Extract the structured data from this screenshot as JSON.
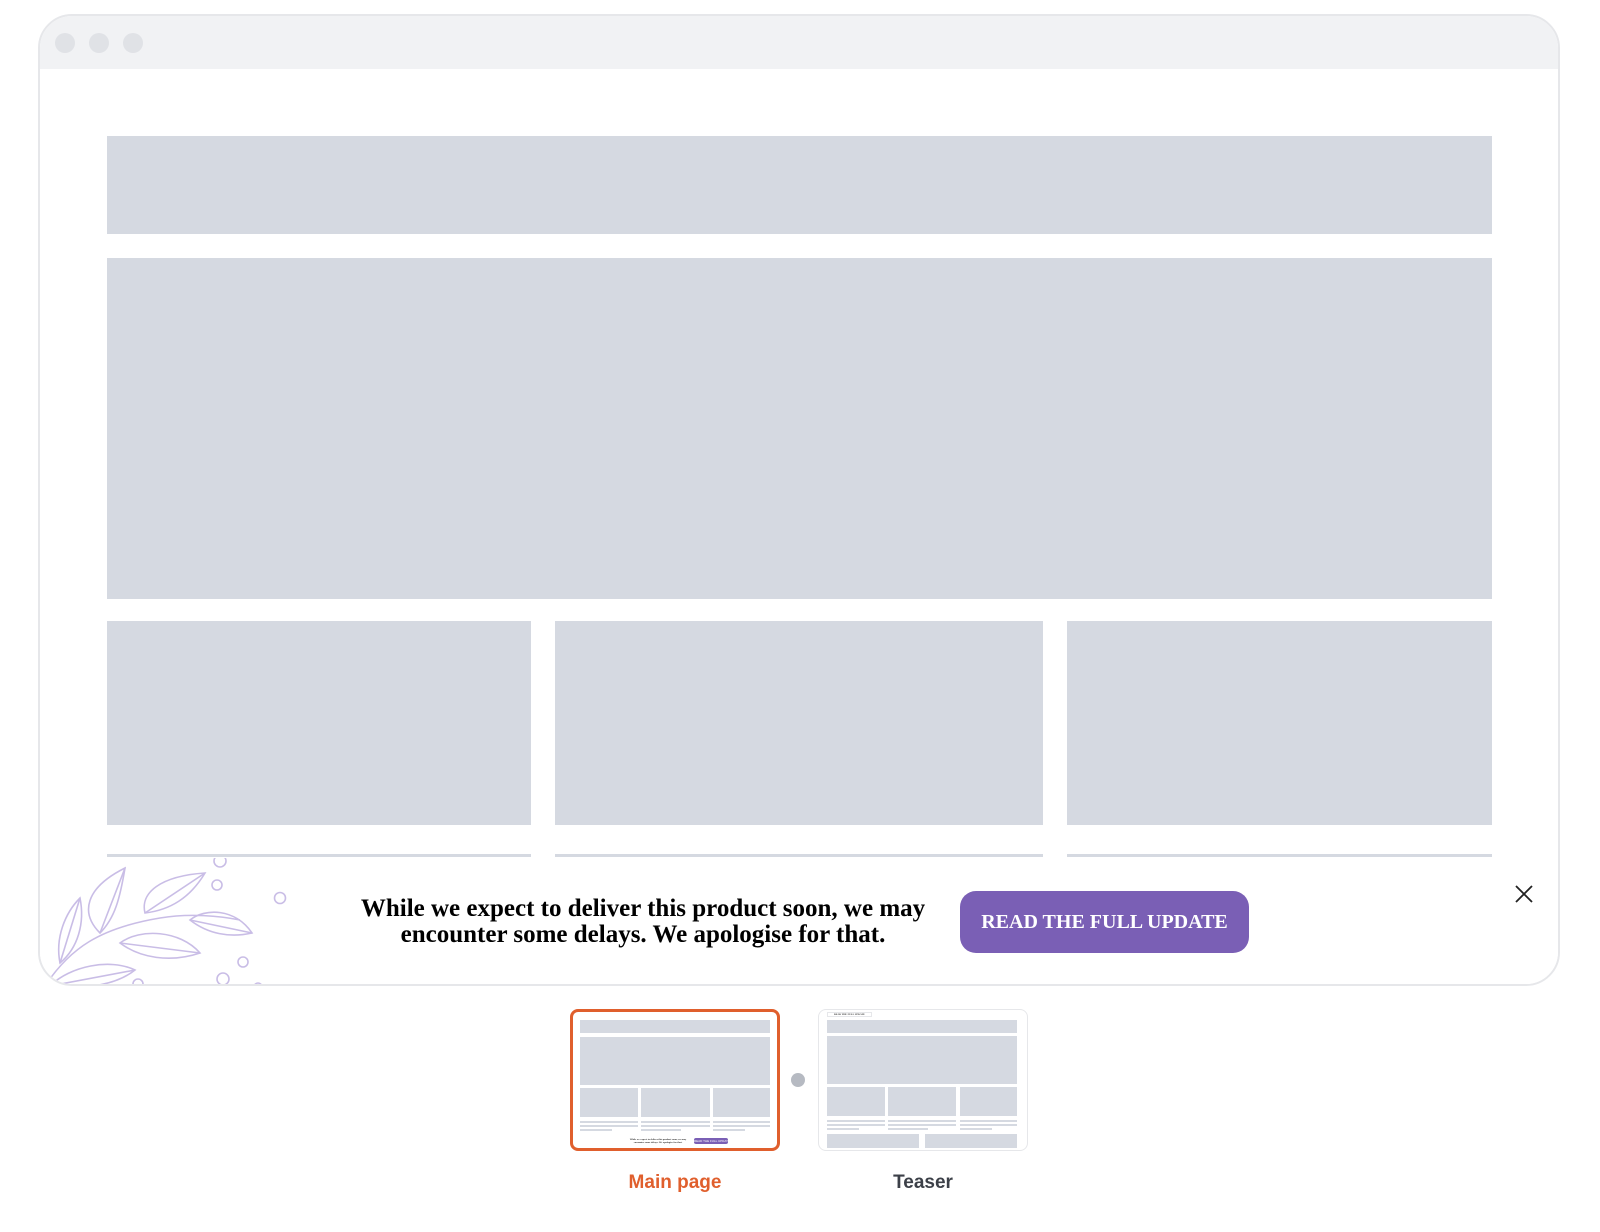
{
  "banner": {
    "message_line1": "While we expect to deliver this product soon, we may",
    "message_line2": "encounter some delays. We apologise for that.",
    "cta_label": "READ THE FULL UPDATE"
  },
  "thumbnails": {
    "main": {
      "label": "Main page",
      "mini_message": "While we expect to deliver this product soon, we may encounter some delays. We apologise for that.",
      "mini_cta": "READ THE FULL UPDATE"
    },
    "teaser": {
      "label": "Teaser",
      "mini_tab_text": "READ THE FULL UPDATE"
    }
  },
  "colors": {
    "cta_background": "#7a5fb5",
    "active_thumbnail_border": "#e05f2d",
    "active_label": "#e05f2d",
    "inactive_label": "#3c4048",
    "placeholder": "#d5d9e1"
  }
}
